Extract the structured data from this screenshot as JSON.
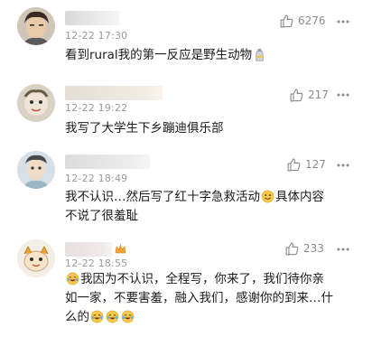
{
  "comments": [
    {
      "time": "12-22 17:30",
      "likes": "6276",
      "text": "看到rural我的第一反应是野生动物",
      "trailing_icon": "bottle-emoji-icon"
    },
    {
      "time": "12-22 19:22",
      "likes": "217",
      "text": "我写了大学生下乡蹦迪俱乐部"
    },
    {
      "time": "12-22 18:49",
      "likes": "127",
      "text_line1_before": "我不认识…然后写了红十字急救活动",
      "text_line1_after": "具体内容",
      "text_line2": "不说了很羞耻",
      "inline_icon": "smile-emoji-icon"
    },
    {
      "time": "12-22 18:55",
      "likes": "233",
      "text_line1": "我因为不认识，全程写，你来了，我们待你亲",
      "text_line2": "如一家，不要害羞，融入我们，感谢你的到来…什",
      "text_line3": "么的",
      "lead_icon": "laughing-crying-emoji-icon",
      "trailing_icons": [
        "laughing-crying-emoji-icon",
        "laughing-crying-emoji-icon",
        "laughing-crying-emoji-icon"
      ]
    }
  ],
  "icons": {
    "like": "thumbs-up-icon",
    "more": "more-dots-icon"
  },
  "colors": {
    "text": "#1b1b1b",
    "meta": "#9a9a9a",
    "icon": "#8c8c8c",
    "emoji": "#f6c84c"
  }
}
